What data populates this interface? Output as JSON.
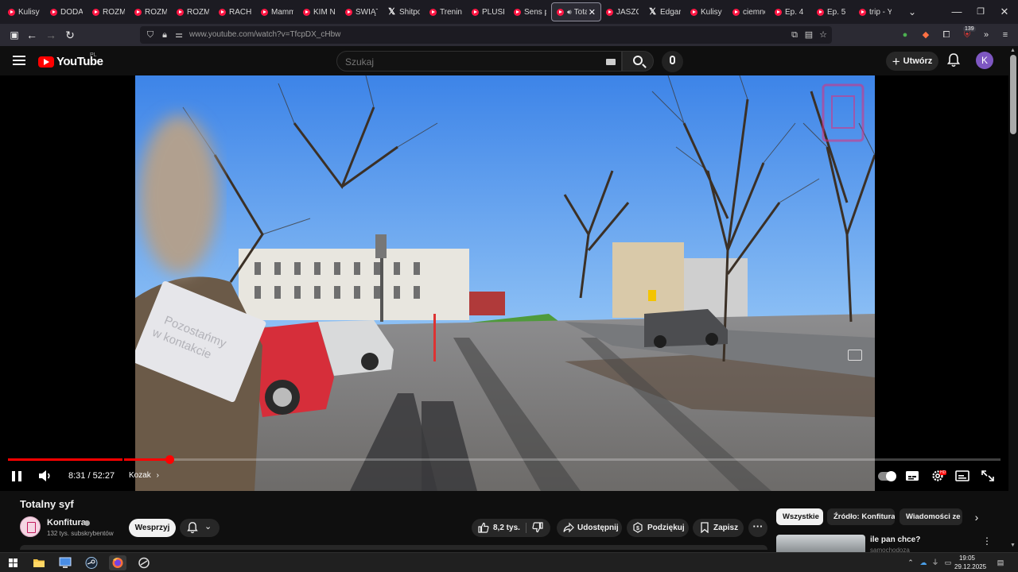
{
  "browser": {
    "tabs": [
      {
        "label": "Kulisy",
        "icon": "youtube-icon"
      },
      {
        "label": "DODA",
        "icon": "youtube-icon"
      },
      {
        "label": "ROZM",
        "icon": "youtube-icon"
      },
      {
        "label": "ROZM",
        "icon": "youtube-icon"
      },
      {
        "label": "ROZM",
        "icon": "youtube-icon"
      },
      {
        "label": "RACHU",
        "icon": "youtube-icon"
      },
      {
        "label": "Mamm",
        "icon": "youtube-icon"
      },
      {
        "label": "KIM N",
        "icon": "youtube-icon"
      },
      {
        "label": "ŚWIĄT",
        "icon": "youtube-icon"
      },
      {
        "label": "Shitpo",
        "icon": "x-icon"
      },
      {
        "label": "Trening",
        "icon": "youtube-icon"
      },
      {
        "label": "PLUSK",
        "icon": "youtube-icon"
      },
      {
        "label": "Sens p",
        "icon": "youtube-icon"
      },
      {
        "label": "Tota",
        "icon": "youtube-icon",
        "active": true
      },
      {
        "label": "JASZC",
        "icon": "youtube-icon"
      },
      {
        "label": "Edgar",
        "icon": "x-icon"
      },
      {
        "label": "Kulisy",
        "icon": "youtube-icon"
      },
      {
        "label": "ciemne",
        "icon": "youtube-icon"
      },
      {
        "label": "Ep. 4",
        "icon": "youtube-icon"
      },
      {
        "label": "Ep. 5",
        "icon": "youtube-icon"
      },
      {
        "label": "trip - Y",
        "icon": "youtube-icon"
      }
    ],
    "url": "www.youtube.com/watch?v=TfcpDX_cHbw",
    "extension_badge": "139"
  },
  "youtube": {
    "logo_text": "YouTube",
    "country_code": "PL",
    "search_placeholder": "Szukaj",
    "create_label": "Utwórz",
    "avatar_letter": "K"
  },
  "player": {
    "current_time": "8:31",
    "duration": "52:27",
    "time_separator": " / ",
    "chapter": "Kozak",
    "played_fraction": 0.1624,
    "buffered_fraction": 0.118,
    "chapter_mark_fraction": 0.115,
    "settings_badge": "HD",
    "video_sign_text_1": "Pozostańmy",
    "video_sign_text_2": "w kontakcie"
  },
  "video": {
    "title": "Totalny syf",
    "channel_name": "Konfitura",
    "subscribers": "132 tys. subskrybentów",
    "support_label": "Wesprzyj",
    "likes": "8,2 tys.",
    "share_label": "Udostępnij",
    "thanks_label": "Podziękuj",
    "save_label": "Zapisz"
  },
  "sidebar": {
    "chips": [
      "Wszystkie",
      "Źródło: Konfitura",
      "Wiadomości ze"
    ],
    "recommendation": {
      "title": "ile pan chce?",
      "channel": "samochodoza"
    }
  },
  "taskbar": {
    "time": "19:05",
    "date": "29.12.2025"
  }
}
